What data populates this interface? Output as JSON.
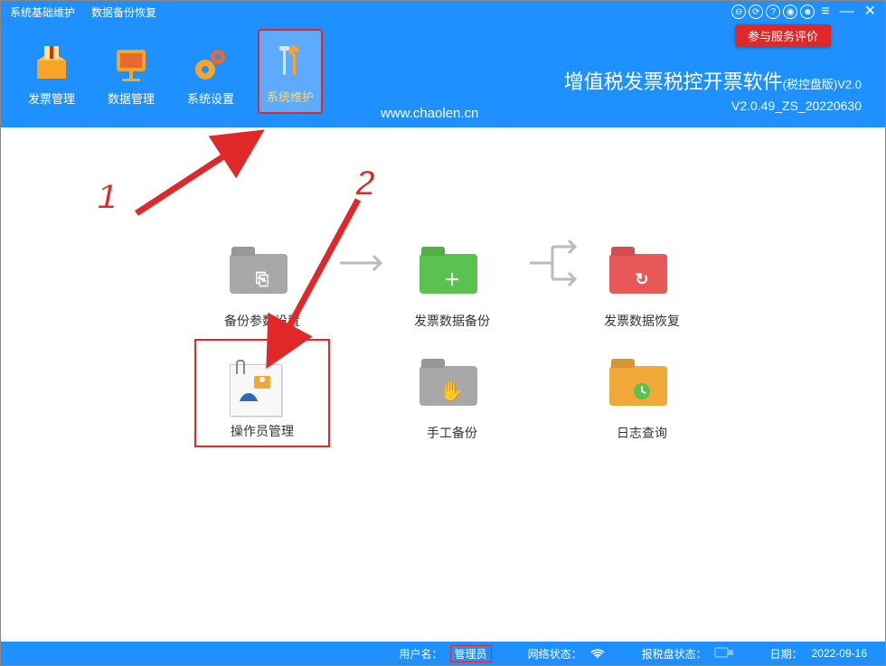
{
  "menu": {
    "item1": "系统基础维护",
    "item2": "数据备份恢复"
  },
  "badge": "参与服务评价",
  "toolbar": {
    "invoice": "发票管理",
    "data": "数据管理",
    "settings": "系统设置",
    "maintenance": "系统维护"
  },
  "app": {
    "title": "增值税发票税控开票软件",
    "edition": "(税控盘版)V2.0",
    "version": "V2.0.49_ZS_20220630",
    "url": "www.chaolen.cn"
  },
  "tiles": {
    "backup_params": "备份参数设置",
    "invoice_backup": "发票数据备份",
    "invoice_restore": "发票数据恢复",
    "operator_mgmt": "操作员管理",
    "manual_backup": "手工备份",
    "log_query": "日志查询"
  },
  "anno": {
    "one": "1",
    "two": "2"
  },
  "status": {
    "user_label": "用户名：",
    "user_value": "管理员",
    "net_label": "网络状态：",
    "tax_label": "报税盘状态：",
    "date_label": "日期：",
    "date_value": "2022-09-16"
  }
}
